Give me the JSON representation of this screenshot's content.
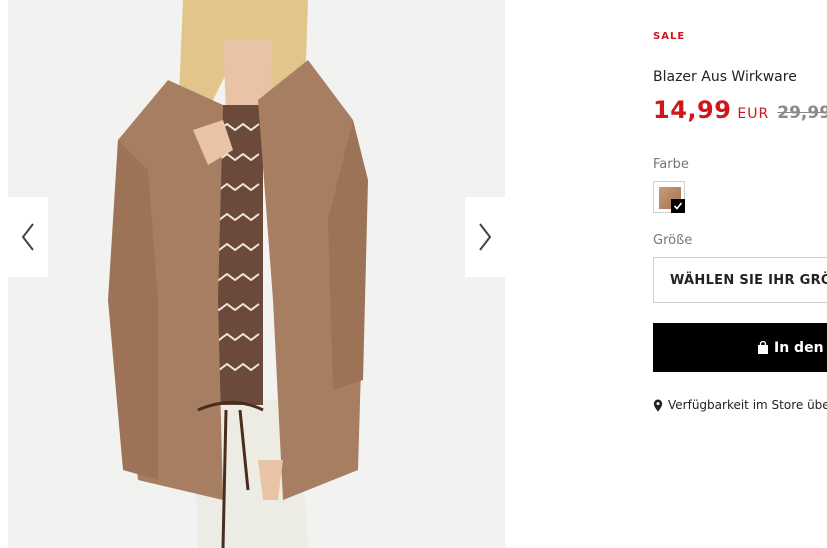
{
  "gallery": {
    "image_description_icon": "product-photo",
    "prev_icon": "chevron-left-icon",
    "next_icon": "chevron-right-icon"
  },
  "product": {
    "badge": "SALE",
    "title": "Blazer Aus Wirkware",
    "price": "14,99",
    "currency": "EUR",
    "old_price": "29,99",
    "color_label": "Farbe",
    "size_label": "Größe",
    "size_placeholder": "WÄHLEN SIE IHR GRÖ",
    "cart_button": "In den",
    "store_availability": "Verfügbarkeit im Store übe"
  },
  "colors": {
    "sale_red": "#d0161d",
    "swatch": "#b8876a",
    "button_bg": "#000000"
  }
}
